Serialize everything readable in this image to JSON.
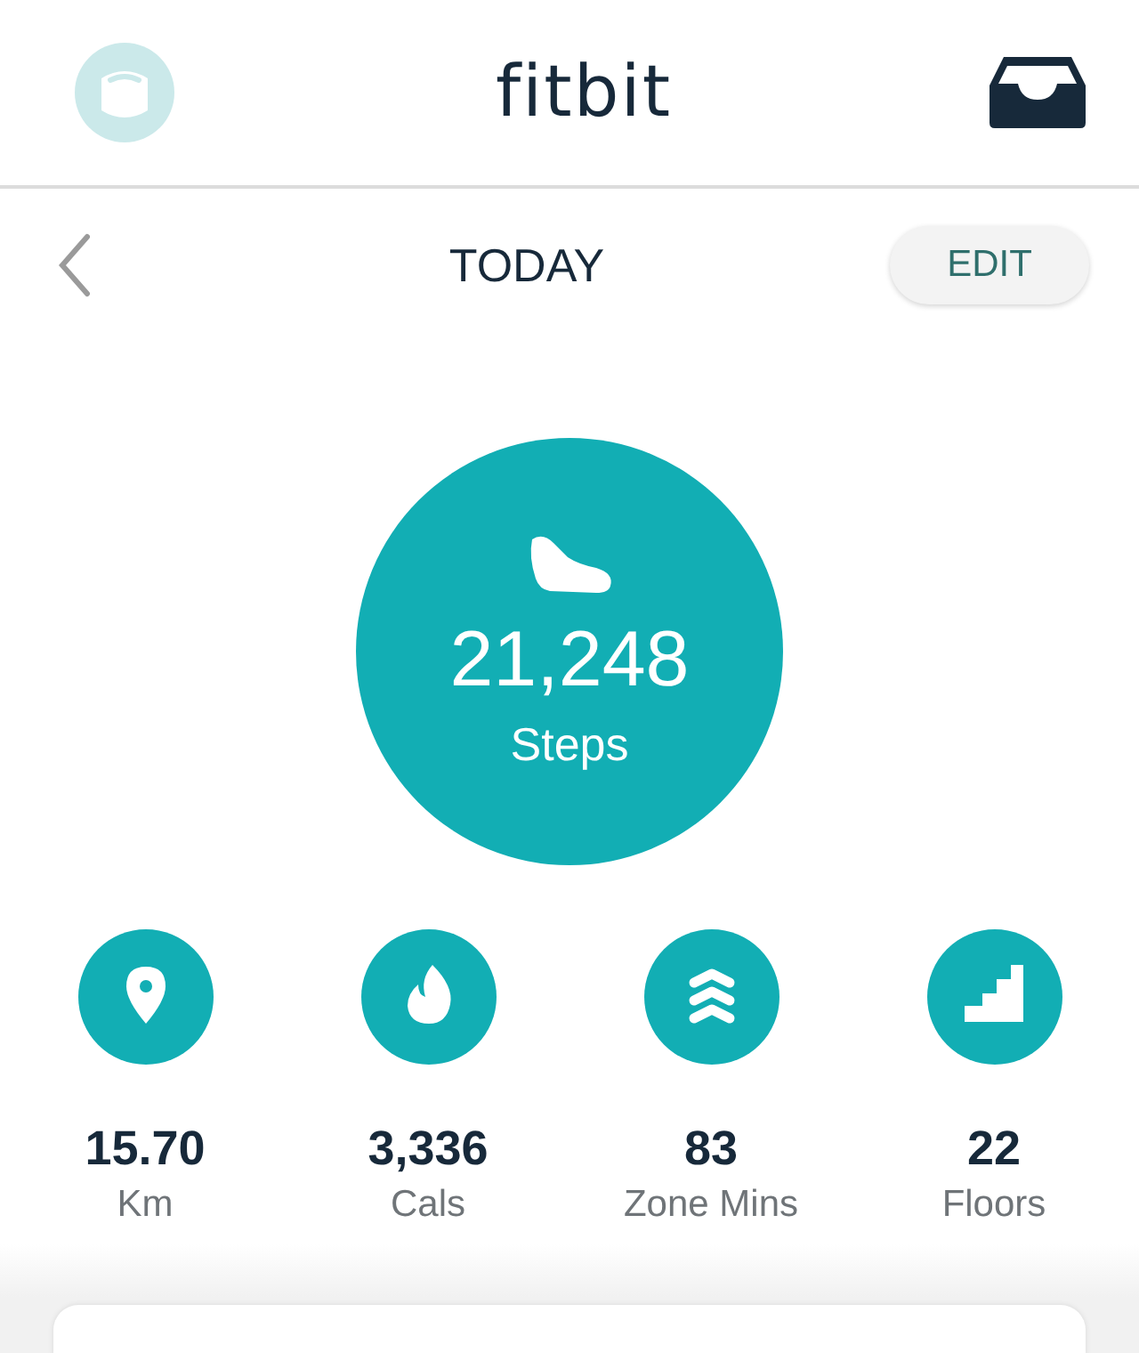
{
  "header": {
    "logo": "fitbit"
  },
  "nav": {
    "title": "TODAY",
    "edit_button": "EDIT"
  },
  "steps": {
    "value": "21,248",
    "label": "Steps"
  },
  "stats": [
    {
      "kind": "distance",
      "value": "15.70",
      "label": "Km"
    },
    {
      "kind": "calories",
      "value": "3,336",
      "label": "Cals"
    },
    {
      "kind": "zone",
      "value": "83",
      "label": "Zone Mins"
    },
    {
      "kind": "floors",
      "value": "22",
      "label": "Floors"
    }
  ]
}
